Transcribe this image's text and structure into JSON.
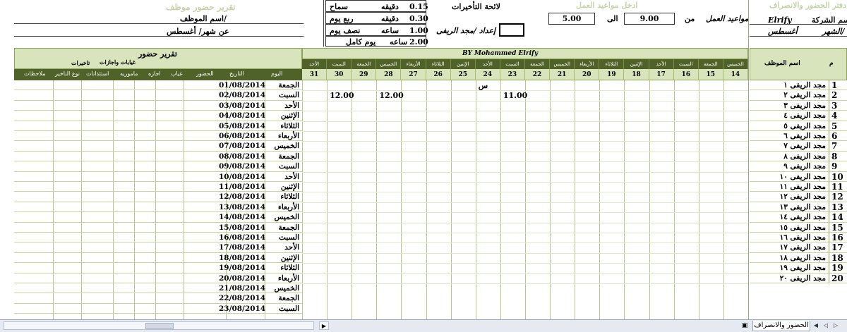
{
  "header": {
    "report_title": "تقرير حضور موظف",
    "employee_label": "اسم الموظف/",
    "month_label_left": "عن شهر/ أغسطس",
    "penalty_title": "لائحة التأخيرات",
    "penalties": [
      {
        "value": "0.15",
        "unit": "دقيقه",
        "desc": "سماح"
      },
      {
        "value": "0.30",
        "unit": "دقيقه",
        "desc": "ربع يوم"
      },
      {
        "value": "1.00",
        "unit": "ساعه",
        "desc": "نصف يوم"
      },
      {
        "value": "2.00",
        "unit": "ساعه",
        "desc": "يوم كامل"
      }
    ],
    "prepared_by": "إعداد /مجد الريفى",
    "enter_hours": "ادخل مواعيد العمل",
    "work_hours_label": "مواعيد العمل",
    "from_label": "من",
    "from_value": "9.00",
    "to_label": "الى",
    "to_value": "5.00",
    "book_title": "دفتر الحضور والانصراف",
    "company_label": "اسم الشركة/",
    "company_value": "Elrify",
    "month_label": "الشهر/",
    "month_value": "أغسطس"
  },
  "report": {
    "title": "تقرير حضور",
    "group_absence": "غيابات واجازات",
    "group_delays": "تاخيرات",
    "columns": [
      "اليوم",
      "التاريخ",
      "الحضور",
      "غياب",
      "اجازه",
      "ماموريه",
      "استئذانات",
      "نوع التاخير",
      "ملاحظات"
    ],
    "rows": [
      {
        "day": "الجمعة",
        "date": "01/08/2014"
      },
      {
        "day": "السبت",
        "date": "02/08/2014"
      },
      {
        "day": "الأحد",
        "date": "03/08/2014"
      },
      {
        "day": "الإثنين",
        "date": "04/08/2014"
      },
      {
        "day": "الثلاثاء",
        "date": "05/08/2014"
      },
      {
        "day": "الأربعاء",
        "date": "06/08/2014"
      },
      {
        "day": "الخميس",
        "date": "07/08/2014"
      },
      {
        "day": "الجمعة",
        "date": "08/08/2014"
      },
      {
        "day": "السبت",
        "date": "09/08/2014"
      },
      {
        "day": "الأحد",
        "date": "10/08/2014"
      },
      {
        "day": "الإثنين",
        "date": "11/08/2014"
      },
      {
        "day": "الثلاثاء",
        "date": "12/08/2014"
      },
      {
        "day": "الأربعاء",
        "date": "13/08/2014"
      },
      {
        "day": "الخميس",
        "date": "14/08/2014"
      },
      {
        "day": "الجمعة",
        "date": "15/08/2014"
      },
      {
        "day": "السبت",
        "date": "16/08/2014"
      },
      {
        "day": "الأحد",
        "date": "17/08/2014"
      },
      {
        "day": "الإثنين",
        "date": "18/08/2014"
      },
      {
        "day": "الثلاثاء",
        "date": "19/08/2014"
      },
      {
        "day": "الأربعاء",
        "date": "20/08/2014"
      },
      {
        "day": "الخميس",
        "date": "21/08/2014"
      },
      {
        "day": "الجمعة",
        "date": "22/08/2014"
      },
      {
        "day": "السبت",
        "date": "23/08/2014"
      }
    ]
  },
  "grid": {
    "credit": "BY Mohammed Elrify",
    "name_header": "اسم الموظف",
    "num_header": "م",
    "day_columns": [
      {
        "name": "الخميس",
        "num": "14"
      },
      {
        "name": "الجمعة",
        "num": "15"
      },
      {
        "name": "السبت",
        "num": "16"
      },
      {
        "name": "الأحد",
        "num": "17"
      },
      {
        "name": "الإثنين",
        "num": "18"
      },
      {
        "name": "الثلاثاء",
        "num": "19"
      },
      {
        "name": "الأربعاء",
        "num": "20"
      },
      {
        "name": "الخميس",
        "num": "21"
      },
      {
        "name": "الجمعة",
        "num": "22"
      },
      {
        "name": "السبت",
        "num": "23"
      },
      {
        "name": "الأحد",
        "num": "24"
      },
      {
        "name": "الإثنين",
        "num": "25"
      },
      {
        "name": "الثلاثاء",
        "num": "26"
      },
      {
        "name": "الأربعاء",
        "num": "27"
      },
      {
        "name": "الخميس",
        "num": "28"
      },
      {
        "name": "الجمعة",
        "num": "29"
      },
      {
        "name": "السبت",
        "num": "30"
      },
      {
        "name": "الأحد",
        "num": "31"
      }
    ],
    "employees": [
      {
        "num": "1",
        "name": "مجد الريفى ١"
      },
      {
        "num": "2",
        "name": "مجد الريفى ٢"
      },
      {
        "num": "3",
        "name": "مجد الريفى ٣"
      },
      {
        "num": "4",
        "name": "مجد الريفى ٤"
      },
      {
        "num": "5",
        "name": "مجد الريفى ٥"
      },
      {
        "num": "6",
        "name": "مجد الريفى ٦"
      },
      {
        "num": "7",
        "name": "مجد الريفى ٧"
      },
      {
        "num": "8",
        "name": "مجد الريفى ٨"
      },
      {
        "num": "9",
        "name": "مجد الريفى ٩"
      },
      {
        "num": "10",
        "name": "مجد الريفى ١٠"
      },
      {
        "num": "11",
        "name": "مجد الريفى ١١"
      },
      {
        "num": "12",
        "name": "مجد الريفى ١٢"
      },
      {
        "num": "13",
        "name": "مجد الريفى ١٣"
      },
      {
        "num": "14",
        "name": "مجد الريفى ١٤"
      },
      {
        "num": "15",
        "name": "مجد الريفى ١٥"
      },
      {
        "num": "16",
        "name": "مجد الريفى ١٦"
      },
      {
        "num": "17",
        "name": "مجد الريفى ١٧"
      },
      {
        "num": "18",
        "name": "مجد الريفى ١٨"
      },
      {
        "num": "19",
        "name": "مجد الريفى ١٩"
      },
      {
        "num": "20",
        "name": "مجد الريفى ٢٠"
      }
    ],
    "entries": [
      {
        "row": 0,
        "col": 10,
        "text": "س"
      },
      {
        "row": 1,
        "col": 9,
        "text": "11.00"
      },
      {
        "row": 1,
        "col": 14,
        "text": "12.00"
      },
      {
        "row": 1,
        "col": 16,
        "text": "12.00"
      }
    ]
  },
  "sheet_tab": "الحضور والانصراف",
  "colors": {
    "header_green": "#d8e4bc",
    "header_dark": "#4f6228",
    "muted_title": "#c6d3a8"
  }
}
